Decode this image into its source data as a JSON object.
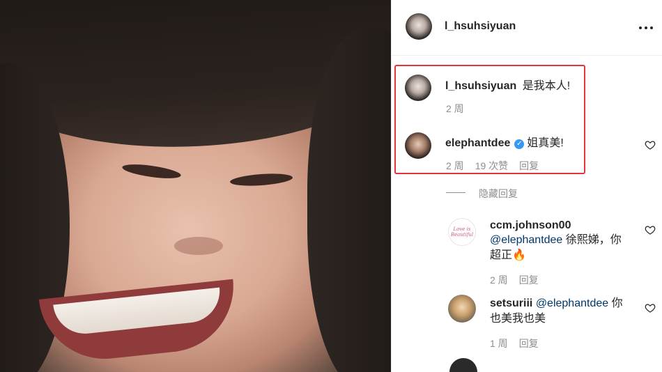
{
  "post": {
    "author": "l_hsuhsiyuan",
    "more_icon": "more-horizontal-icon"
  },
  "comments": [
    {
      "username": "l_hsuhsiyuan",
      "text": "是我本人!",
      "time": "2 周",
      "avatar_icon": "avatar-l_hsuhsiyuan"
    },
    {
      "username": "elephantdee",
      "verified": true,
      "text": "姐真美!",
      "time": "2 周",
      "likes": "19 次赞",
      "reply": "回复",
      "like_icon": "heart-outline-icon",
      "avatar_icon": "avatar-elephantdee"
    }
  ],
  "hide_replies": "隐藏回复",
  "replies": [
    {
      "username": "ccm.johnson00",
      "mention": "@elephantdee",
      "text_line1_rest": " 徐熙娣，你",
      "text_line2": "超正🔥",
      "time": "2 周",
      "reply": "回复",
      "avatar_text": "Love is Beautiful",
      "like_icon": "heart-outline-icon"
    },
    {
      "username": "setsuriii",
      "mention": "@elephantdee",
      "text_line1_rest": " 你",
      "text_line2": "也美我也美",
      "time": "1 周",
      "reply": "回复",
      "avatar_icon": "avatar-setsuriii",
      "like_icon": "heart-outline-icon"
    }
  ],
  "colors": {
    "highlight_border": "#e0363a",
    "mention": "#00376b",
    "meta": "#8e8e8e",
    "verified": "#3897f0"
  }
}
